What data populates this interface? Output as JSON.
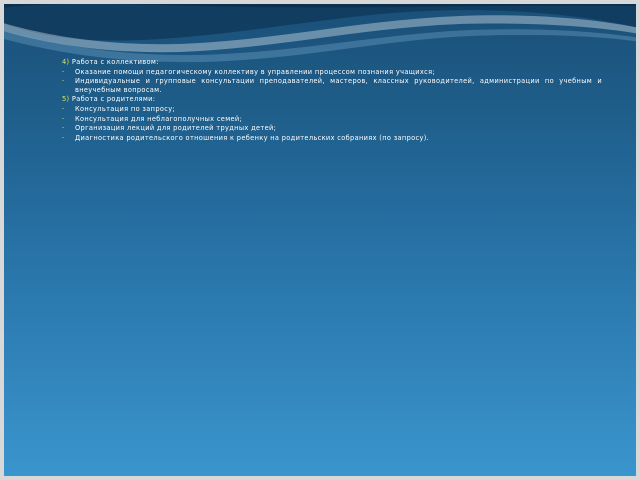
{
  "sections": [
    {
      "number": "4)",
      "title": "Работа с коллективом:",
      "items": [
        "Оказание помощи педагогическому коллективу в управлении процессом познания учащихся;",
        "Индивидуальные и групповые консультации преподавателей, мастеров, классных руководителей, администрации по учебным и внеучебным вопросам."
      ]
    },
    {
      "number": "5)",
      "title": "Работа с родителями:",
      "items": [
        "Консультация по запросу;",
        "Консультация для неблагополучных семей;",
        "Организация лекций для родителей трудных детей;",
        "Диагностика родительского отношения к ребенку на родительских собраниях (по запросу)."
      ]
    }
  ],
  "bullet_glyph": "-",
  "colors": {
    "background_top": "#1a4f77",
    "background_bottom": "#3a96cd",
    "text": "#ffffff",
    "number_accent": "#d9e85a",
    "bullet_accent": "#e8e35a",
    "frame": "#d8d8d8"
  }
}
